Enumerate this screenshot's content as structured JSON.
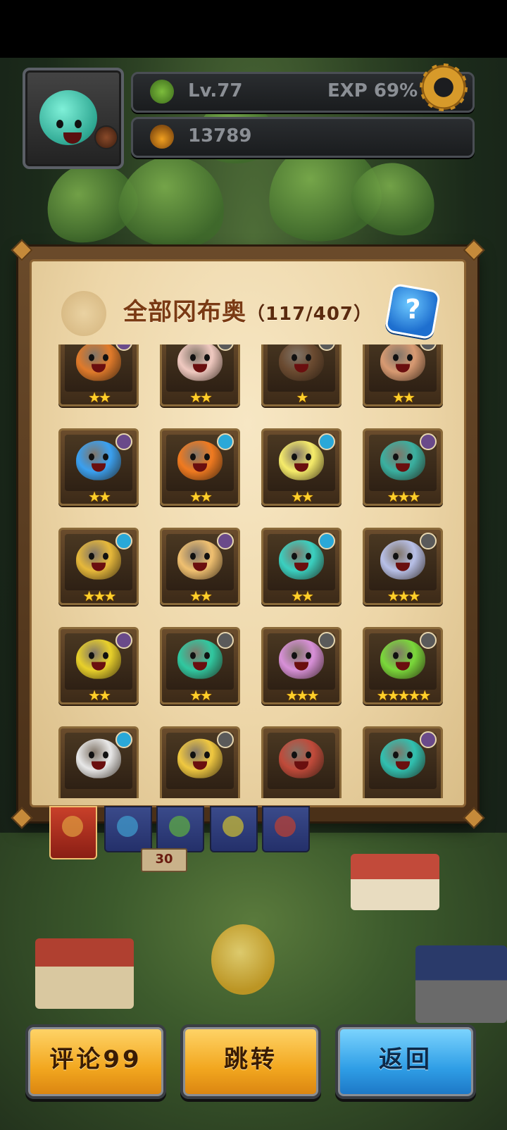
{
  "hud": {
    "level": "Lv.77",
    "exp": "EXP 69%",
    "currency": "13789",
    "avatar_icon": "teal-blob-avatar",
    "level_icon": "tree-icon",
    "currency_icon": "fruit-basket-icon",
    "settings_icon": "gear-icon"
  },
  "modal": {
    "title": "全部冈布奥",
    "count": "（117/407）",
    "help_label": "?",
    "cards": [
      {
        "badge": "purple",
        "stars": "★★",
        "color": "#e07a2a"
      },
      {
        "badge": "gray",
        "stars": "★★",
        "color": "#f0c9c0"
      },
      {
        "badge": "gray",
        "stars": "★",
        "color": "#6a4a30"
      },
      {
        "badge": "gray",
        "stars": "★★",
        "color": "#d89a72"
      },
      {
        "badge": "purple",
        "stars": "★★",
        "color": "#3aa0f0"
      },
      {
        "badge": "blue",
        "stars": "★★",
        "color": "#f07a20"
      },
      {
        "badge": "blue",
        "stars": "★★",
        "color": "#f6ec6a"
      },
      {
        "badge": "purple",
        "stars": "★★★",
        "color": "#3ab0a0"
      },
      {
        "badge": "blue",
        "stars": "★★★",
        "color": "#e6b83a"
      },
      {
        "badge": "purple",
        "stars": "★★",
        "color": "#f0c070"
      },
      {
        "badge": "blue",
        "stars": "★★",
        "color": "#3ad0c0"
      },
      {
        "badge": "gray",
        "stars": "★★★",
        "color": "#b8c0e8"
      },
      {
        "badge": "purple",
        "stars": "★★",
        "color": "#e8d02a"
      },
      {
        "badge": "gray",
        "stars": "★★",
        "color": "#30c8a0"
      },
      {
        "badge": "gray",
        "stars": "★★★",
        "color": "#d890d8"
      },
      {
        "badge": "gray",
        "stars": "★★★★★",
        "color": "#7ad83a"
      },
      {
        "badge": "blue",
        "stars": "",
        "color": "#e8e8e8"
      },
      {
        "badge": "gray",
        "stars": "",
        "color": "#f0c840"
      },
      {
        "badge": "",
        "stars": "",
        "color": "#c04a3a"
      },
      {
        "badge": "purple",
        "stars": "",
        "color": "#30c0b0"
      }
    ]
  },
  "tabs": [
    {
      "name": "all",
      "color": "#e0a040"
    },
    {
      "name": "blue",
      "color": "#40a0d0"
    },
    {
      "name": "green",
      "color": "#60b040"
    },
    {
      "name": "yellow",
      "color": "#d0c030"
    },
    {
      "name": "red",
      "color": "#c04030"
    }
  ],
  "scene": {
    "sign": "30"
  },
  "buttons": {
    "comment": "评论99",
    "jump": "跳转",
    "back": "返回"
  }
}
